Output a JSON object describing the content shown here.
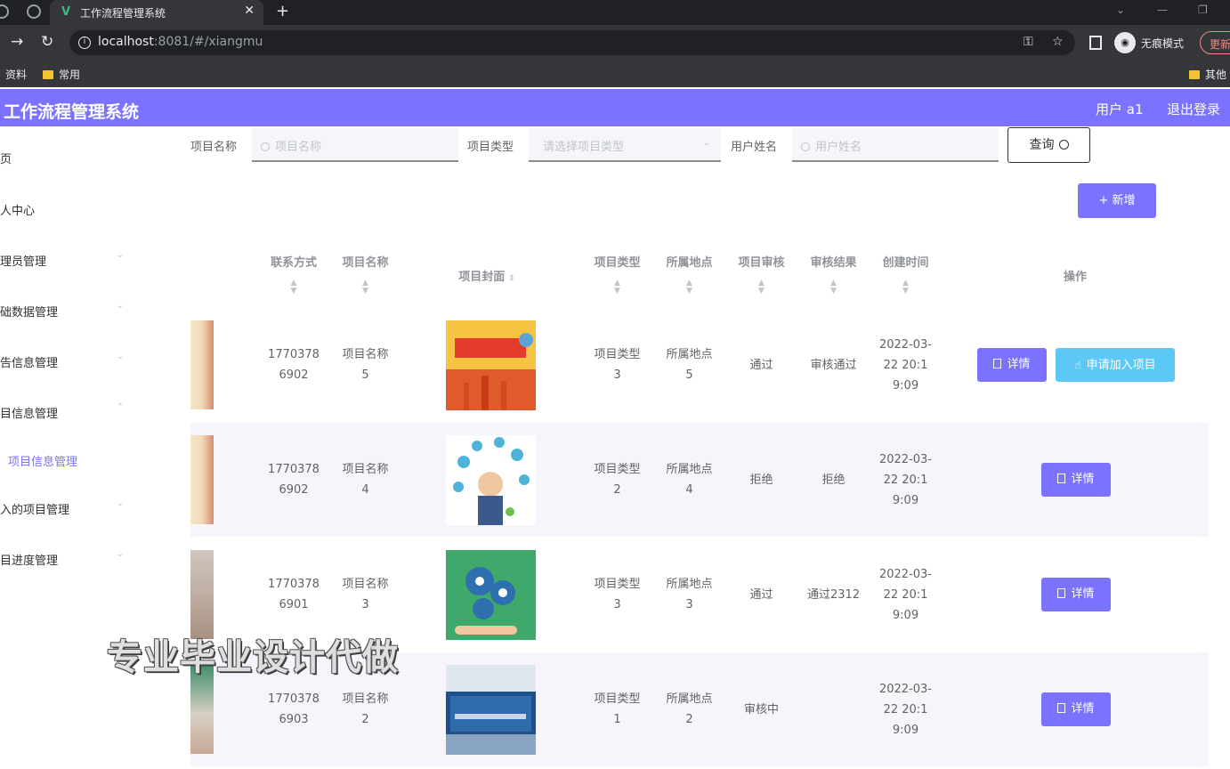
{
  "browser": {
    "tab_title": "工作流程管理系统",
    "url_host": "localhost",
    "url_rest": ":8081/#/xiangmu",
    "incognito_label": "无痕模式",
    "update_label": "更新",
    "bookmarks": [
      "资料",
      "常用",
      "其他"
    ]
  },
  "header": {
    "title": "工作流程管理系统",
    "user": "用户 a1",
    "logout": "退出登录"
  },
  "sidebar": {
    "items": [
      {
        "label": "首页"
      },
      {
        "label": "个人中心"
      },
      {
        "label": "管理员管理"
      },
      {
        "label": "基础数据管理"
      },
      {
        "label": "公告信息管理"
      },
      {
        "label": "项目信息管理"
      },
      {
        "label": "项目信息管理"
      },
      {
        "label": "加入的项目管理"
      },
      {
        "label": "项目进度管理"
      }
    ]
  },
  "search": {
    "name_label": "项目名称",
    "name_placeholder": "项目名称",
    "type_label": "项目类型",
    "type_placeholder": "请选择项目类型",
    "user_label": "用户姓名",
    "user_placeholder": "用户姓名",
    "query_button": "查询"
  },
  "add_button": "+ 新增",
  "table": {
    "columns": [
      "联系方式",
      "项目名称",
      "项目封面",
      "项目类型",
      "所属地点",
      "项目审核",
      "审核结果",
      "创建时间",
      "操作"
    ],
    "rows": [
      {
        "phone": "17703786902",
        "name": "项目名称5",
        "type": "项目类型3",
        "place": "所属地点5",
        "audit": "通过",
        "result": "审核通过",
        "created": "2022-03-22 20:19:09",
        "actions": [
          "详情",
          "申请加入项目"
        ]
      },
      {
        "phone": "17703786902",
        "name": "项目名称4",
        "type": "项目类型2",
        "place": "所属地点4",
        "audit": "拒绝",
        "result": "拒绝",
        "created": "2022-03-22 20:19:09",
        "actions": [
          "详情"
        ]
      },
      {
        "phone": "17703786901",
        "name": "项目名称3",
        "type": "项目类型3",
        "place": "所属地点3",
        "audit": "通过",
        "result": "通过2312",
        "created": "2022-03-22 20:19:09",
        "actions": [
          "详情"
        ]
      },
      {
        "phone": "17703786903",
        "name": "项目名称2",
        "type": "项目类型1",
        "place": "所属地点2",
        "audit": "审核中",
        "result": "",
        "created": "2022-03-22 20:19:09",
        "actions": [
          "详情"
        ]
      }
    ]
  },
  "watermark": "专业毕业设计代做",
  "colors": {
    "accent": "#7b73ff",
    "apply": "#5bc8f5"
  }
}
